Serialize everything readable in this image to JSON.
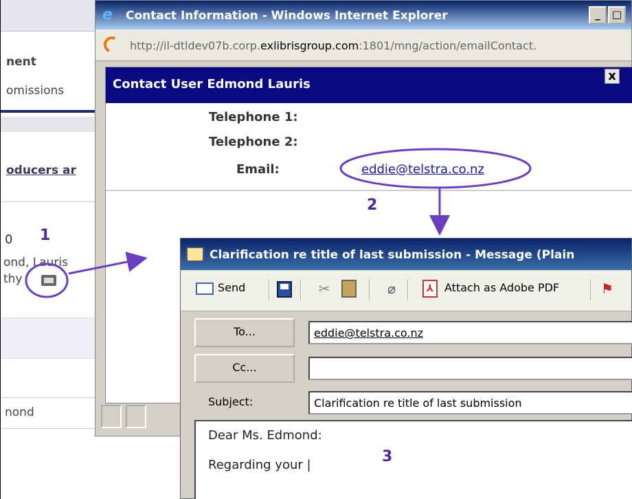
{
  "background_app": {
    "nav_text": "nent",
    "tab_text": "omissions",
    "producers_link": "oducers ar",
    "zero_value": "0",
    "contact_name_line1": "ond, Lauris",
    "contact_name_line2": "thy",
    "name_cell": "nond"
  },
  "ie_window": {
    "title": "Contact Information - Windows Internet Explorer",
    "url_prefix": "http://il-dtldev07b.corp.",
    "url_domain": "exlibrisgroup.com",
    "url_suffix": ":1801/mng/action/emailContact.",
    "contact_header": "Contact User  Edmond Lauris",
    "close_label": "x",
    "telephone1_label": "Telephone 1:",
    "telephone2_label": "Telephone 2:",
    "email_label": "Email:",
    "email_value": "eddie@telstra.co.nz"
  },
  "message_window": {
    "title": "Clarification re title of last submission - Message (Plain",
    "toolbar": {
      "send_label": "Send",
      "attach_pdf_label": "Attach as Adobe PDF"
    },
    "to_button": "To...",
    "cc_button": "Cc...",
    "to_value": "eddie@telstra.co.nz",
    "cc_value": "",
    "subject_label": "Subject:",
    "subject_value": "Clarification re title of last submission",
    "body_line1": "Dear Ms. Edmond:",
    "body_line2": "Regarding your |"
  },
  "annotations": {
    "step1": "1",
    "step2": "2",
    "step3": "3",
    "color": "#6a3fbf"
  }
}
